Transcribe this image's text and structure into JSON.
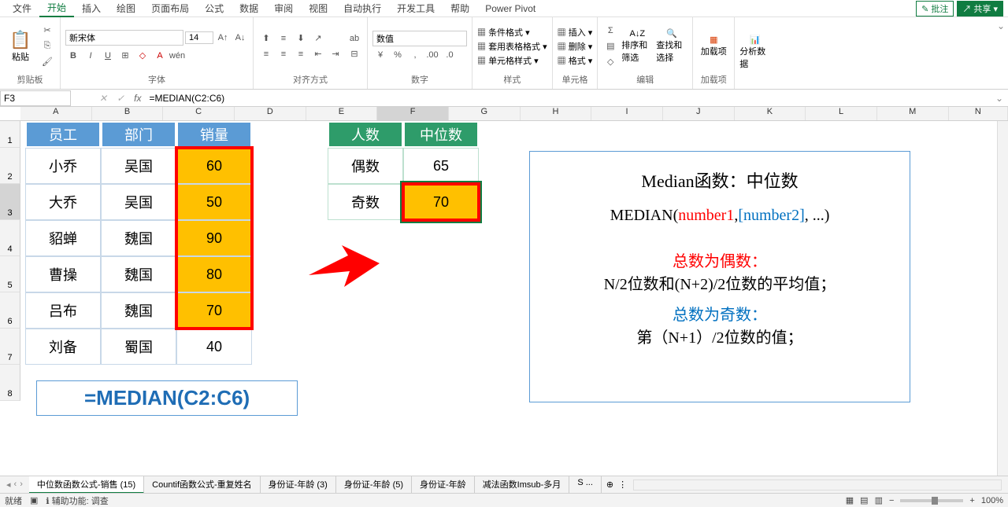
{
  "menu": {
    "items": [
      "文件",
      "开始",
      "插入",
      "绘图",
      "页面布局",
      "公式",
      "数据",
      "审阅",
      "视图",
      "自动执行",
      "开发工具",
      "帮助",
      "Power Pivot"
    ],
    "active_index": 1,
    "comment_btn": "批注",
    "share_btn": "共享"
  },
  "ribbon": {
    "clipboard": {
      "paste": "粘贴",
      "label": "剪贴板"
    },
    "font": {
      "name": "新宋体",
      "size": "14",
      "label": "字体"
    },
    "alignment": {
      "label": "对齐方式"
    },
    "number": {
      "format": "数值",
      "label": "数字"
    },
    "styles": {
      "conditional": "条件格式",
      "table": "套用表格格式",
      "cell": "单元格样式",
      "label": "样式"
    },
    "cells": {
      "insert": "插入",
      "delete": "删除",
      "format": "格式",
      "label": "单元格"
    },
    "editing": {
      "sort": "排序和筛选",
      "find": "查找和选择",
      "label": "编辑"
    },
    "addins": {
      "btn": "加载项",
      "label": "加载项"
    },
    "analysis": {
      "btn": "分析数据"
    }
  },
  "name_box": "F3",
  "formula": "=MEDIAN(C2:C6)",
  "columns": [
    "A",
    "B",
    "C",
    "D",
    "E",
    "F",
    "G",
    "H",
    "I",
    "J",
    "K",
    "L",
    "M",
    "N"
  ],
  "rows": [
    "1",
    "2",
    "3",
    "4",
    "5",
    "6",
    "7",
    "8"
  ],
  "chart_data": {
    "type": "table",
    "table1": {
      "headers": [
        "员工",
        "部门",
        "销量"
      ],
      "rows": [
        [
          "小乔",
          "吴国",
          60
        ],
        [
          "大乔",
          "吴国",
          50
        ],
        [
          "貂蝉",
          "魏国",
          90
        ],
        [
          "曹操",
          "魏国",
          80
        ],
        [
          "吕布",
          "魏国",
          70
        ],
        [
          "刘备",
          "蜀国",
          40
        ]
      ]
    },
    "table2": {
      "headers": [
        "人数",
        "中位数"
      ],
      "rows": [
        [
          "偶数",
          65
        ],
        [
          "奇数",
          70
        ]
      ]
    }
  },
  "formula_display": "=MEDIAN(C2:C6)",
  "info": {
    "title": "Median函数：中位数",
    "syntax_pre": "MEDIAN(",
    "syntax_n1": "number1",
    "syntax_sep1": ",",
    "syntax_n2": "[number2]",
    "syntax_post": ", ...)",
    "even_title": "总数为偶数：",
    "even_desc": "N/2位数和(N+2)/2位数的平均值；",
    "odd_title": "总数为奇数：",
    "odd_desc": "第（N+1）/2位数的值；"
  },
  "tabs": {
    "items": [
      "中位数函数公式-销售 (15)",
      "Countif函数公式-重复姓名",
      "身份证-年龄 (3)",
      "身份证-年龄 (5)",
      "身份证-年龄",
      "减法函数Imsub-多月",
      "S ..."
    ],
    "active_index": 0
  },
  "status": {
    "ready": "就绪",
    "accessibility": "辅助功能: 调查",
    "zoom": "100%"
  }
}
